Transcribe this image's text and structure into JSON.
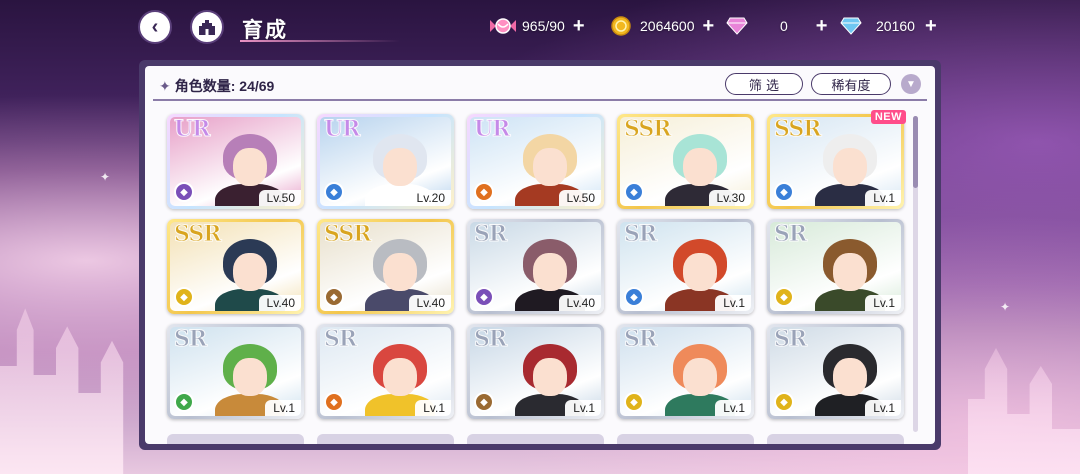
{
  "header": {
    "title": "育成"
  },
  "resources": [
    {
      "name": "candy",
      "icon": "candy-icon",
      "value": "965/90"
    },
    {
      "name": "gold",
      "icon": "coin-icon",
      "value": "2064600"
    },
    {
      "name": "pink-gem",
      "icon": "pink-diamond-icon",
      "value": "0"
    },
    {
      "name": "blue-gem",
      "icon": "blue-diamond-icon",
      "value": "20160"
    }
  ],
  "panel": {
    "count_label": "角色数量: 24/69",
    "filter_label": "筛 选",
    "sort_label": "稀有度"
  },
  "cards": [
    {
      "rarity": "UR",
      "level": "Lv.50",
      "element": "purple",
      "hair": "#b77fb8",
      "bg": "#e7a0c8",
      "body": "#3a2030",
      "new": ""
    },
    {
      "rarity": "UR",
      "level": "Lv.20",
      "element": "blue",
      "hair": "#e0e6f0",
      "bg": "#b7d3ee",
      "body": "#ffffff",
      "new": ""
    },
    {
      "rarity": "UR",
      "level": "Lv.50",
      "element": "orange",
      "hair": "#f3d6a4",
      "bg": "#cde3f5",
      "body": "#a53a22",
      "new": ""
    },
    {
      "rarity": "SSR",
      "level": "Lv.30",
      "element": "blue",
      "hair": "#a8e4d6",
      "bg": "#f6efd8",
      "body": "#2e2a36",
      "new": ""
    },
    {
      "rarity": "SSR",
      "level": "Lv.1",
      "element": "blue",
      "hair": "#eeeeee",
      "bg": "#d6e6f3",
      "body": "#2a2d44",
      "new": "NEW"
    },
    {
      "rarity": "SSR",
      "level": "Lv.40",
      "element": "yellow",
      "hair": "#2b3a55",
      "bg": "#f3e1b5",
      "body": "#1f4a4a",
      "new": ""
    },
    {
      "rarity": "SSR",
      "level": "Lv.40",
      "element": "bronze",
      "hair": "#b9bcc2",
      "bg": "#e8e0cc",
      "body": "#4a4a6a",
      "new": ""
    },
    {
      "rarity": "SR",
      "level": "Lv.40",
      "element": "purple",
      "hair": "#8a5c6a",
      "bg": "#c9d9e6",
      "body": "#1f1a22",
      "new": ""
    },
    {
      "rarity": "SR",
      "level": "Lv.1",
      "element": "blue",
      "hair": "#d2492a",
      "bg": "#cfe3ef",
      "body": "#8a3524",
      "new": ""
    },
    {
      "rarity": "SR",
      "level": "Lv.1",
      "element": "yellow",
      "hair": "#8a5a2e",
      "bg": "#d7ead9",
      "body": "#3a4a2a",
      "new": ""
    },
    {
      "rarity": "SR",
      "level": "Lv.1",
      "element": "green",
      "hair": "#5fb04a",
      "bg": "#cfe2ef",
      "body": "#c88a3a",
      "new": ""
    },
    {
      "rarity": "SR",
      "level": "Lv.1",
      "element": "orange",
      "hair": "#d9473f",
      "bg": "#dde8f2",
      "body": "#f0c22a",
      "new": ""
    },
    {
      "rarity": "SR",
      "level": "Lv.1",
      "element": "bronze",
      "hair": "#a82a30",
      "bg": "#c7d7e6",
      "body": "#2a2a30",
      "new": ""
    },
    {
      "rarity": "SR",
      "level": "Lv.1",
      "element": "yellow",
      "hair": "#ef8a5a",
      "bg": "#cfe0ee",
      "body": "#2e7a5e",
      "new": ""
    },
    {
      "rarity": "SR",
      "level": "Lv.1",
      "element": "yellow",
      "hair": "#2a2a2e",
      "bg": "#cfdbe6",
      "body": "#1f2024",
      "new": ""
    }
  ],
  "element_colors": {
    "purple": "#7a4fb8",
    "blue": "#3a7fd8",
    "orange": "#e0701f",
    "yellow": "#e0b31a",
    "bronze": "#9a6a32",
    "green": "#3fa84a"
  }
}
